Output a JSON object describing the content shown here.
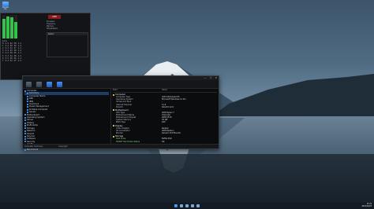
{
  "desktop": {
    "icon_label": "Recycle Bin"
  },
  "monitor": {
    "brand": "AMD",
    "cpu_bars": [
      0.82,
      0.95,
      0.9,
      0.7
    ],
    "rows": [
      [
        "Core",
        "",
        "",
        "",
        ""
      ],
      [
        "0",
        "3.4",
        "42",
        "38",
        "1.2"
      ],
      [
        "1",
        "3.4",
        "40",
        "36",
        "1.2"
      ],
      [
        "2",
        "3.3",
        "41",
        "37",
        "1.1"
      ],
      [
        "3",
        "3.4",
        "43",
        "39",
        "1.2"
      ],
      [
        "4",
        "3.2",
        "39",
        "35",
        "1.1"
      ],
      [
        "5",
        "3.4",
        "42",
        "38",
        "1.2"
      ],
      [
        "6",
        "3.3",
        "40",
        "36",
        "1.1"
      ],
      [
        "7",
        "3.4",
        "41",
        "37",
        "1.2"
      ]
    ],
    "info_lines": [
      "Processor",
      "Frequency",
      "Memory",
      "Temperature"
    ],
    "box_title": "Sensor"
  },
  "window": {
    "controls": {
      "minimize": "—",
      "maximize": "☐",
      "close": "✕"
    },
    "tree": [
      {
        "label": "Computer",
        "level": 0
      },
      {
        "label": "Summary",
        "level": 1
      },
      {
        "label": "Computer Name",
        "level": 1
      },
      {
        "label": "DMI",
        "level": 1
      },
      {
        "label": "IPMI",
        "level": 1
      },
      {
        "label": "Overclock",
        "level": 1
      },
      {
        "label": "Power Management",
        "level": 1
      },
      {
        "label": "Portable Computer",
        "level": 1
      },
      {
        "label": "Sensor",
        "level": 1
      },
      {
        "label": "Motherboard",
        "level": 0
      },
      {
        "label": "Operating System",
        "level": 0
      },
      {
        "label": "Server",
        "level": 0
      },
      {
        "label": "Display",
        "level": 0
      },
      {
        "label": "Multimedia",
        "level": 0
      },
      {
        "label": "Storage",
        "level": 0
      },
      {
        "label": "Network",
        "level": 0
      },
      {
        "label": "DirectX",
        "level": 0
      },
      {
        "label": "Devices",
        "level": 0
      },
      {
        "label": "Software",
        "level": 0
      },
      {
        "label": "Security",
        "level": 0
      },
      {
        "label": "Config",
        "level": 0
      },
      {
        "label": "Database",
        "level": 0
      },
      {
        "label": "Benchmark",
        "level": 0
      }
    ],
    "columns": [
      "Field",
      "Value"
    ],
    "sections": [
      {
        "title": "Computer",
        "rows": [
          [
            "Computer Type",
            "ACPI x64-based PC"
          ],
          [
            "Operating System",
            "Microsoft Windows 11 Pro"
          ],
          [
            "OS Service Pack",
            "-"
          ],
          [
            "Internet Explorer",
            "11.0"
          ],
          [
            "DirectX",
            "DirectX 12.0"
          ]
        ]
      },
      {
        "title": "Motherboard",
        "rows": [
          [
            "CPU Type",
            "AMD Ryzen 7"
          ],
          [
            "Motherboard Name",
            "Unknown"
          ],
          [
            "Motherboard Chipset",
            "AMD X570"
          ],
          [
            "System Memory",
            "32 GB"
          ],
          [
            "BIOS Type",
            "AMI"
          ]
        ]
      },
      {
        "title": "Display",
        "rows": [
          [
            "Video Adapter",
            "Radeon"
          ],
          [
            "3D Accelerator",
            "AMD Radeon"
          ],
          [
            "Monitor",
            "Generic PnP Monitor"
          ]
        ]
      },
      {
        "title": "Storage",
        "rows": [
          [
            "Disk Drive",
            "NVMe SSD"
          ],
          [
            "SMART Hard Disks Status",
            "OK"
          ]
        ],
        "ok": true
      }
    ],
    "status_left": "Computer Summary",
    "status_right": "Copyright"
  },
  "taskbar": {
    "time": "11:01",
    "date": "2022/10/23"
  }
}
